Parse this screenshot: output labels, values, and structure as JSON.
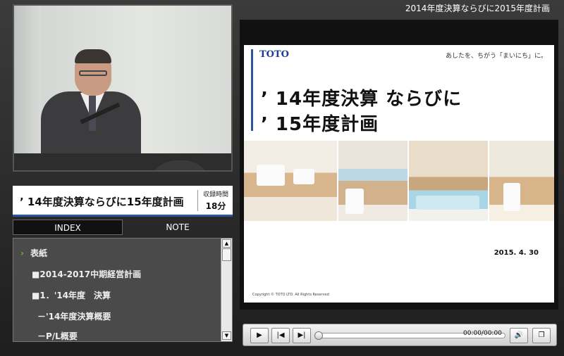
{
  "header": {
    "title": "2014年度決算ならびに2015年度計画"
  },
  "program": {
    "title": "’ 14年度決算ならびに15年度計画",
    "record_time_label": "収録時間",
    "record_time_value": "18分"
  },
  "tabs": [
    {
      "label": "INDEX",
      "active": true
    },
    {
      "label": "NOTE",
      "active": false
    }
  ],
  "index": {
    "items": [
      {
        "label": "表紙",
        "current": true
      },
      {
        "label": "■2014-2017中期経営計画"
      },
      {
        "label": "■1．'14年度　決算"
      },
      {
        "label": "－'14年度決算概要"
      },
      {
        "label": "－P/L概要"
      }
    ]
  },
  "slide": {
    "logo": "TOTO",
    "tagline": "あしたを、ちがう「まいにち」に。",
    "heading_line1": "’ 14年度決算 ならびに",
    "heading_line2": "’ 15年度計画",
    "date": "2015. 4. 30",
    "copyright": "Copyright © TOTO LTD. All Rights Reserved"
  },
  "player": {
    "timecode": "00:00/00:00",
    "progress": 0,
    "icons": [
      "play-icon",
      "previous-icon",
      "next-icon",
      "volume-icon",
      "popup-window-icon"
    ]
  },
  "colors": {
    "accent": "#2a55a0",
    "current_marker": "#66bb33"
  }
}
